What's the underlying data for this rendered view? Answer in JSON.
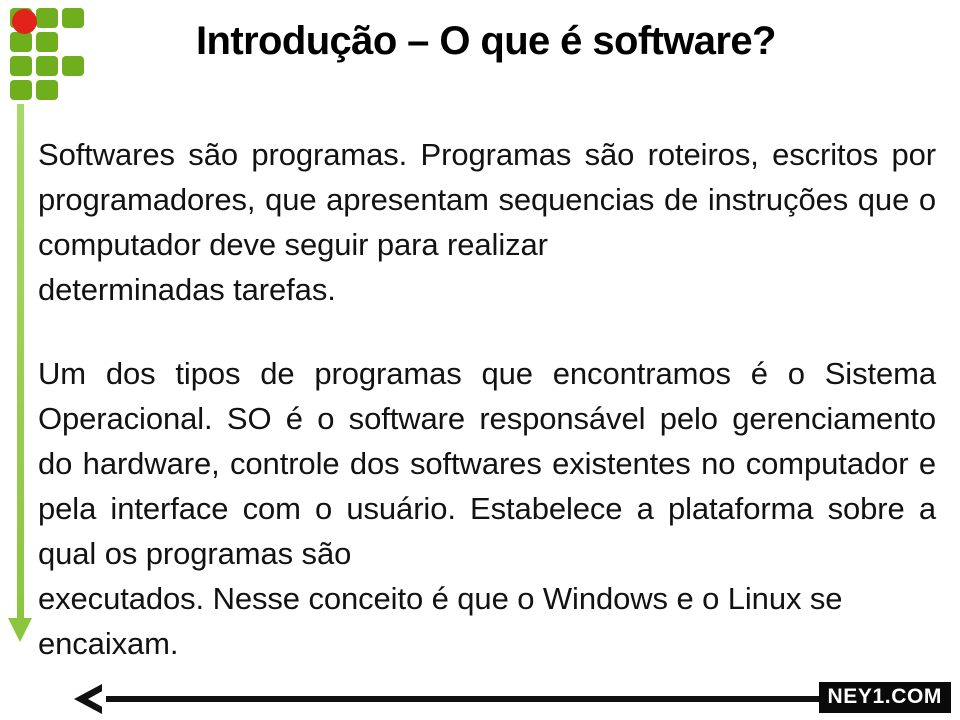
{
  "slide": {
    "title": "Introdução – O que é software?",
    "paragraphs": [
      "Softwares são programas. Programas são roteiros, escritos por programadores, que apresentam sequencias de instruções que o computador deve seguir para realizar",
      "Um dos tipos de programas que encontramos é o Sistema Operacional. SO é o software responsável pelo gerenciamento do hardware, controle dos softwares existentes no computador e pela interface com o usuário. Estabelece a plataforma sobre a qual os programas são"
    ],
    "paragraph_tails": [
      "determinadas tarefas.",
      "executados. Nesse conceito é que o Windows e o Linux se encaixam."
    ],
    "watermark": "NEY1.COM"
  },
  "logo": {
    "name": "if-institute-logo",
    "dot_color": "#e2231a",
    "cell_color": "#6fae1c"
  },
  "decor": {
    "green_rail_color": "#8cc63e",
    "black_arrow_color": "#111111",
    "background_color": "#ffffff",
    "text_color": "#121212"
  }
}
